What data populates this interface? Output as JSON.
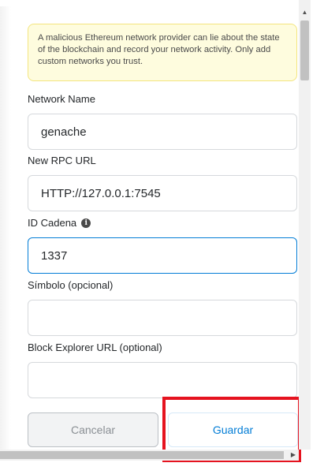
{
  "warning": {
    "text": "A malicious Ethereum network provider can lie about the state of the blockchain and record your network activity. Only add custom networks you trust."
  },
  "form": {
    "network_name": {
      "label": "Network Name",
      "value": "genache"
    },
    "rpc_url": {
      "label": "New RPC URL",
      "value": "HTTP://127.0.0.1:7545"
    },
    "chain_id": {
      "label": "ID Cadena",
      "value": "1337",
      "info_icon": "info-icon"
    },
    "symbol": {
      "label": "Símbolo (opcional)",
      "value": ""
    },
    "explorer_url": {
      "label": "Block Explorer URL (optional)",
      "value": ""
    }
  },
  "buttons": {
    "cancel_label": "Cancelar",
    "save_label": "Guardar"
  },
  "colors": {
    "accent": "#037dd6",
    "warning_bg": "#fefcde",
    "warning_border": "#f3e57e",
    "highlight": "#e5131f"
  }
}
